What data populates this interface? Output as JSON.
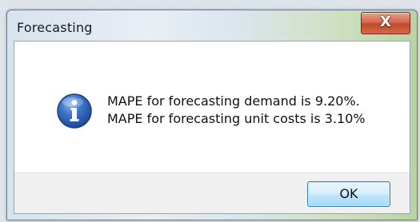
{
  "window": {
    "title": "Forecasting",
    "close_glyph": "X",
    "close_icon": "close-icon"
  },
  "dialog": {
    "icon": "info-icon",
    "message_lines": [
      "MAPE for forecasting demand is 9.20%.",
      "MAPE for forecasting unit costs is 3.10%"
    ],
    "ok_label": "OK"
  },
  "colors": {
    "close_button": "#c24a2c",
    "info_icon": "#2a5fb0",
    "ok_border": "#3c7fb1"
  }
}
